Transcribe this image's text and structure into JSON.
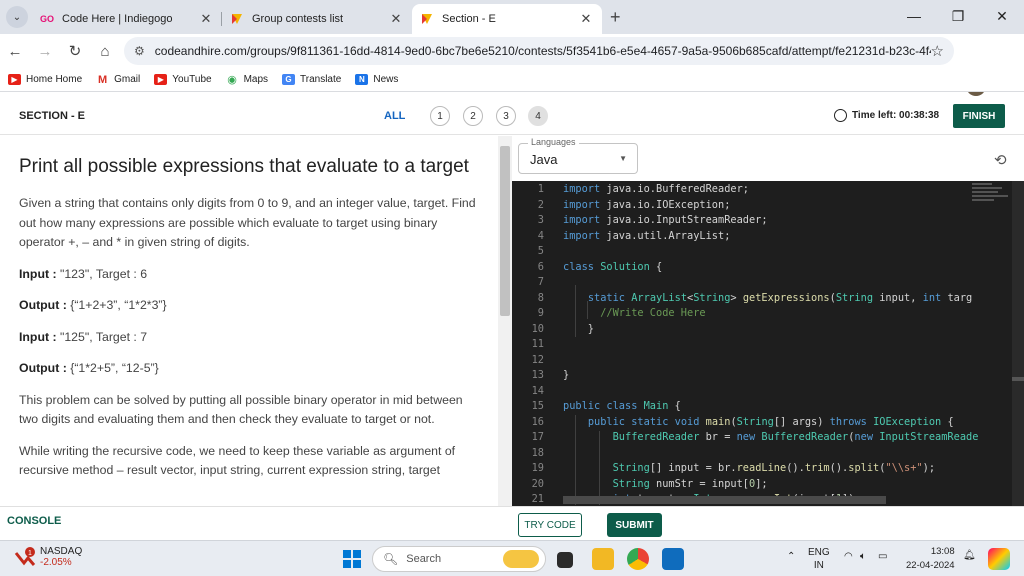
{
  "browser": {
    "tabs": [
      {
        "title": "Code Here | Indiegogo",
        "favicon": "GO"
      },
      {
        "title": "Group contests list",
        "favicon": "ch"
      },
      {
        "title": "Section - E",
        "favicon": "ch",
        "active": true
      }
    ],
    "url": "codeandhire.com/groups/9f811361-16dd-4814-9ed0-6bc7be6e5210/contests/5f3541b6-e5e4-4657-9a5a-9506b685cafd/attempt/fe21231d-b23c-4f41-96f...",
    "bookmarks": [
      "Home Home",
      "Gmail",
      "YouTube",
      "Maps",
      "Translate",
      "News"
    ]
  },
  "header": {
    "section": "SECTION - E",
    "all_label": "ALL",
    "questions": [
      "1",
      "2",
      "3",
      "4"
    ],
    "timer": "Time left: 00:38:38",
    "finish": "FINISH"
  },
  "problem": {
    "title": "Print all possible expressions that evaluate to a target",
    "intro": "Given a string that contains only digits from 0 to 9, and an integer value, target. Find out how many expressions are possible which evaluate to target using binary operator +, – and * in given string of digits.",
    "examples": [
      {
        "label": "Input :",
        "text": " \"123\", Target : 6"
      },
      {
        "label": "Output :",
        "text": " {“1+2+3”, “1*2*3”}"
      },
      {
        "label": "Input :",
        "text": " \"125\", Target : 7"
      },
      {
        "label": "Output :",
        "text": " {“1*2+5”, “12-5”}"
      }
    ],
    "para1": "This problem can be solved by putting all possible binary operator in mid between two digits and evaluating them and then check they evaluate to target or not.",
    "para2": "While writing the recursive code, we need to keep these variable as argument of recursive method – result vector, input string, current expression string, target"
  },
  "editor": {
    "languages_label": "Languages",
    "language": "Java",
    "line_numbers": [
      "1",
      "2",
      "3",
      "4",
      "5",
      "6",
      "7",
      "8",
      "9",
      "10",
      "11",
      "12",
      "13",
      "14",
      "15",
      "16",
      "17",
      "18",
      "19",
      "20",
      "21"
    ]
  },
  "bottom": {
    "console": "CONSOLE",
    "try_code": "TRY CODE",
    "submit": "SUBMIT"
  },
  "taskbar": {
    "stock_name": "NASDAQ",
    "stock_change": "-2.05%",
    "search": "Search",
    "lang1": "ENG",
    "lang2": "IN",
    "time": "13:08",
    "date": "22-04-2024"
  }
}
